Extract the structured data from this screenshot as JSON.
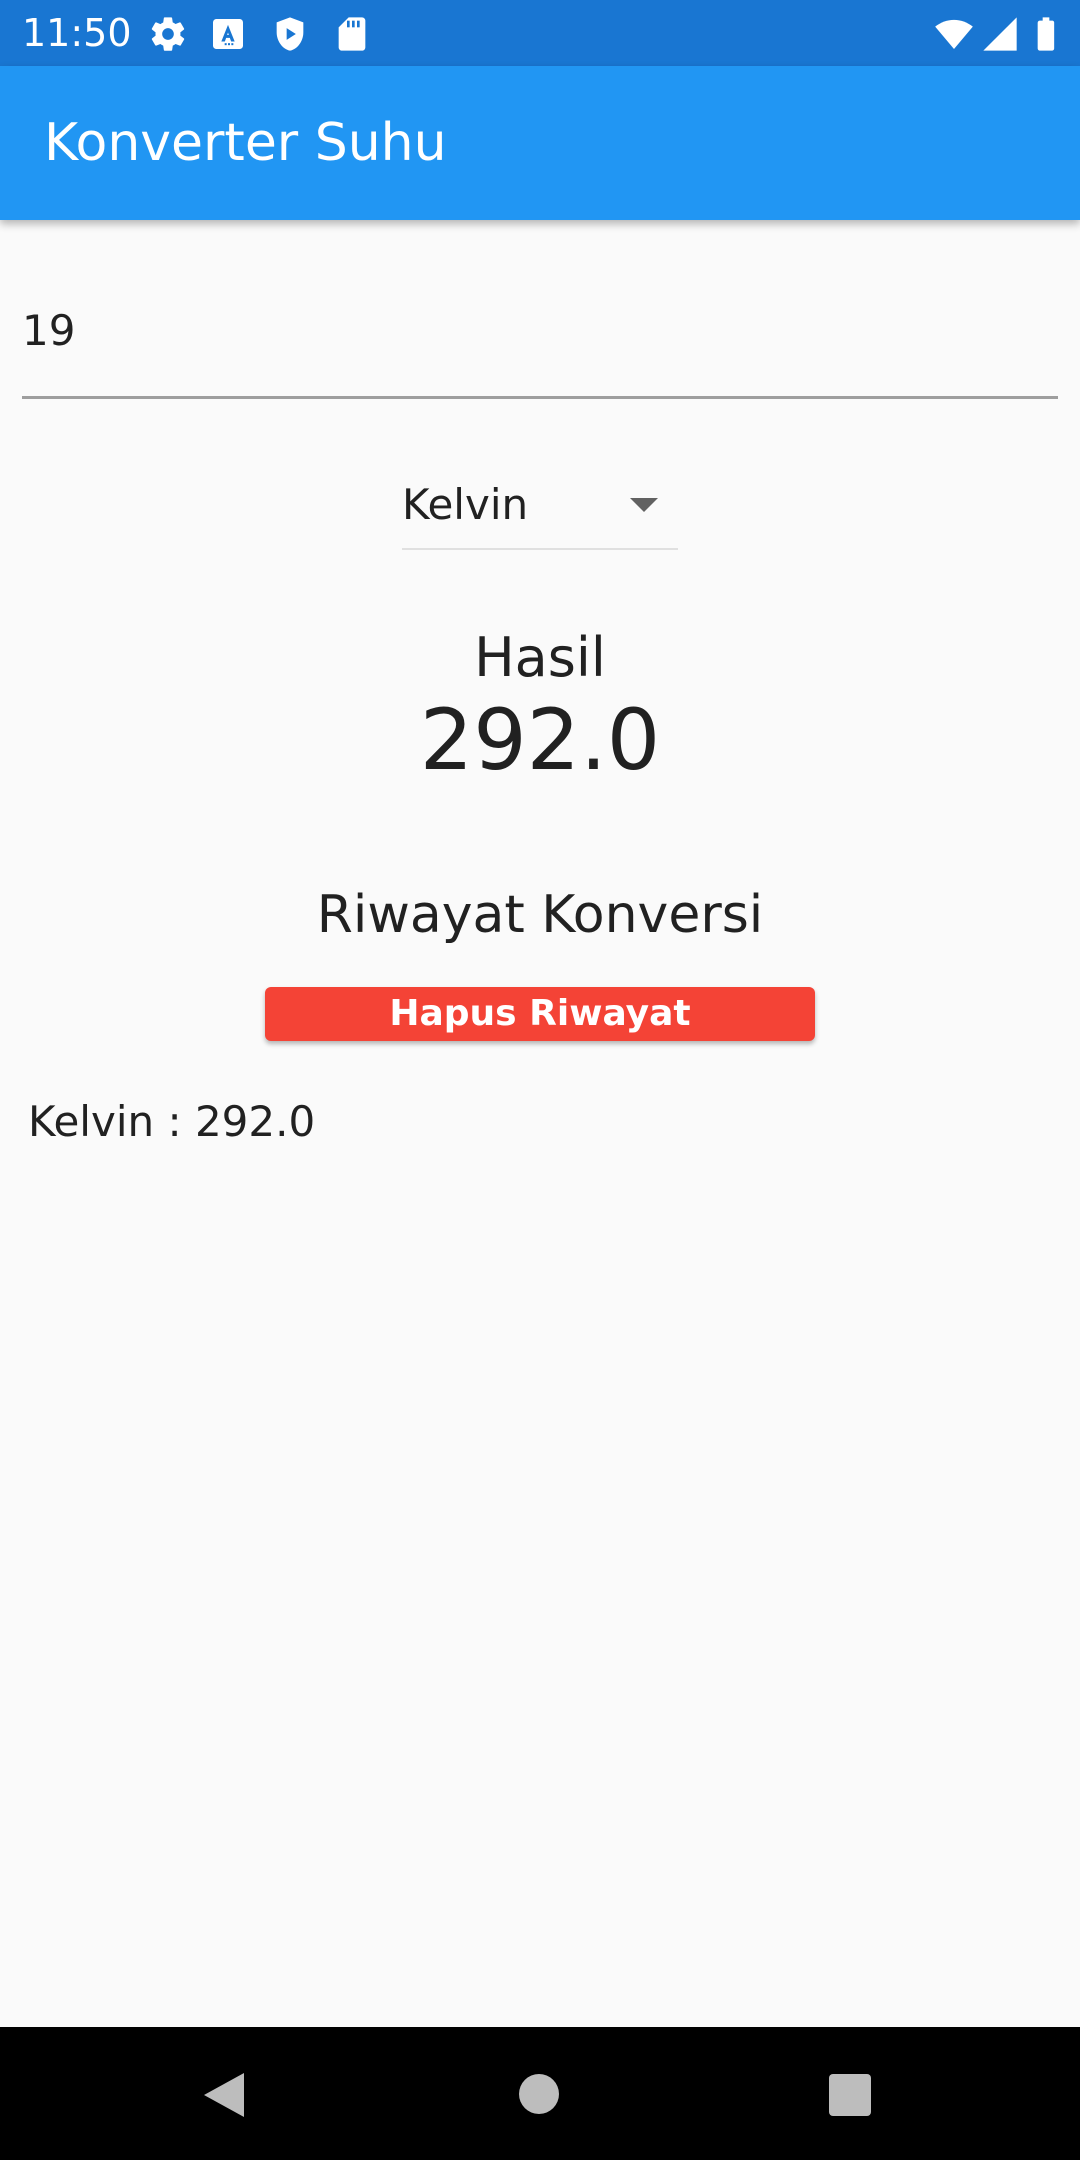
{
  "status_bar": {
    "time": "11:50",
    "icons_left": [
      "gear-icon",
      "a-keyboard-icon",
      "shield-play-icon",
      "sd-card-icon"
    ],
    "icons_right": [
      "wifi-icon",
      "cell-signal-icon",
      "battery-icon"
    ]
  },
  "app_bar": {
    "title": "Konverter Suhu"
  },
  "input": {
    "value": "19"
  },
  "dropdown": {
    "selected": "Kelvin"
  },
  "result": {
    "label": "Hasil",
    "value": "292.0"
  },
  "history": {
    "title": "Riwayat Konversi",
    "clear_label": "Hapus Riwayat",
    "items": [
      "Kelvin : 292.0"
    ]
  },
  "colors": {
    "status_bar": "#1976d2",
    "app_bar": "#2196f3",
    "danger": "#f44336",
    "background": "#fafafa"
  },
  "nav_bar": {
    "icons": [
      "back-icon",
      "home-icon",
      "recent-apps-icon"
    ]
  }
}
